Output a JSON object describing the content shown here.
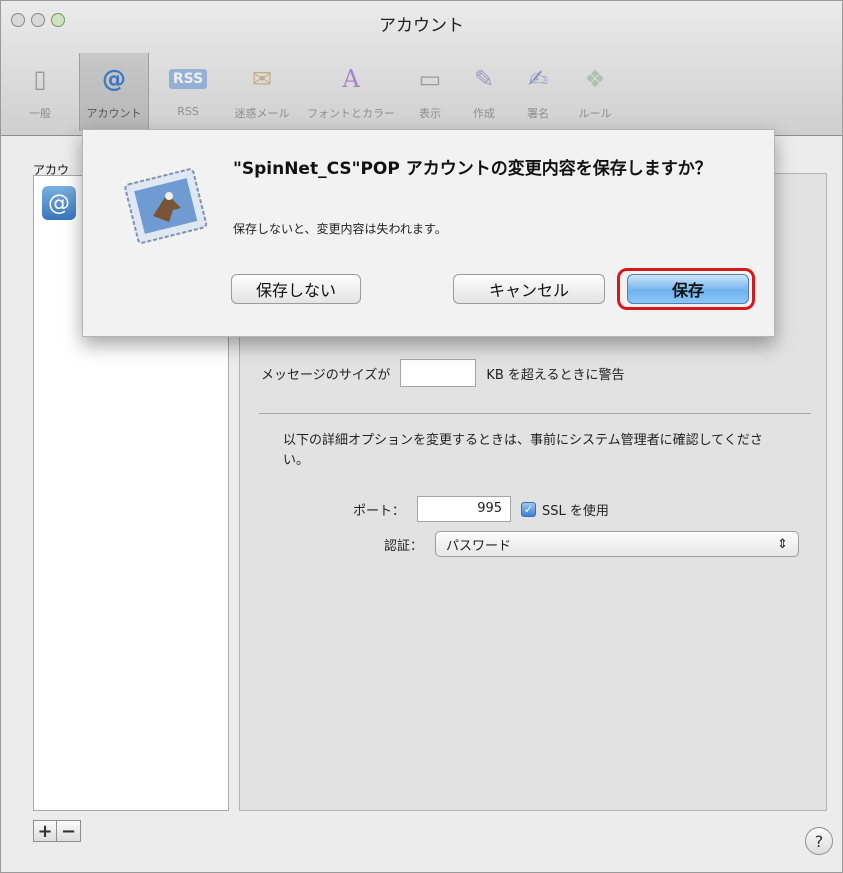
{
  "window": {
    "title": "アカウント"
  },
  "toolbar": {
    "items": [
      {
        "label": "一般",
        "icon": "general-switch-icon",
        "glyph": "▯"
      },
      {
        "label": "アカウント",
        "icon": "at-sign-icon",
        "glyph": "@"
      },
      {
        "label": "RSS",
        "icon": "rss-icon",
        "glyph": "RSS"
      },
      {
        "label": "迷惑メール",
        "icon": "junk-mail-icon",
        "glyph": "✉"
      },
      {
        "label": "フォントとカラー",
        "icon": "font-color-icon",
        "glyph": "A"
      },
      {
        "label": "表示",
        "icon": "view-icon",
        "glyph": "▭"
      },
      {
        "label": "作成",
        "icon": "compose-icon",
        "glyph": "✎"
      },
      {
        "label": "署名",
        "icon": "signature-icon",
        "glyph": "✍"
      },
      {
        "label": "ルール",
        "icon": "rules-icon",
        "glyph": "❖"
      }
    ]
  },
  "accounts": {
    "header": "アカウ",
    "add_label": "+",
    "remove_label": "−"
  },
  "help": {
    "label": "?"
  },
  "settings": {
    "size_label": "メッセージのサイズが",
    "size_value": "",
    "size_suffix": "KB を超えるときに警告",
    "note": "以下の詳細オプションを変更するときは、事前にシステム管理者に確認してください。",
    "port_label": "ポート：",
    "port_value": "995",
    "ssl_label": "SSL を使用",
    "ssl_checked": true,
    "auth_label": "認証：",
    "auth_value": "パスワード"
  },
  "dialog": {
    "title": "\"SpinNet_CS\"POP アカウントの変更内容を保存しますか？",
    "message": "保存しないと、変更内容は失われます。",
    "dont_save_label": "保存しない",
    "cancel_label": "キャンセル",
    "save_label": "保存"
  },
  "colors": {
    "accent": "#6fb3ee",
    "highlight": "#d41a1a"
  }
}
